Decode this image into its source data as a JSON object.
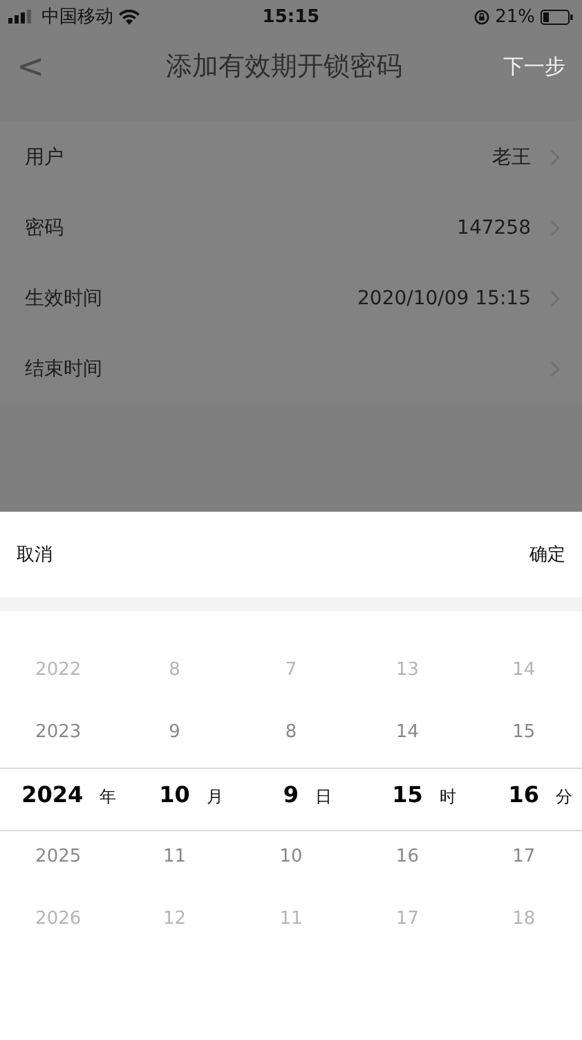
{
  "status_bar": {
    "carrier": "中国移动",
    "time": "15:15",
    "battery": "21%"
  },
  "nav": {
    "back": "<",
    "title": "添加有效期开锁密码",
    "action": "下一步"
  },
  "rows": [
    {
      "label": "用户",
      "value": "老王"
    },
    {
      "label": "密码",
      "value": "147258"
    },
    {
      "label": "生效时间",
      "value": "2020/10/09 15:15"
    },
    {
      "label": "结束时间"
    }
  ],
  "picker": {
    "cancel": "取消",
    "confirm": "确定",
    "columns": [
      {
        "unit": "年",
        "items": [
          {
            "text": "2022",
            "selected": false
          },
          {
            "text": "2023",
            "selected": false
          },
          {
            "text": "2024",
            "selected": true
          },
          {
            "text": "2025",
            "selected": false
          },
          {
            "text": "2026",
            "selected": false
          }
        ]
      },
      {
        "unit": "月",
        "items": [
          {
            "text": "8",
            "selected": false
          },
          {
            "text": "9",
            "selected": false
          },
          {
            "text": "10",
            "selected": true
          },
          {
            "text": "11",
            "selected": false
          },
          {
            "text": "12",
            "selected": false
          }
        ]
      },
      {
        "unit": "日",
        "items": [
          {
            "text": "7",
            "selected": false
          },
          {
            "text": "8",
            "selected": false
          },
          {
            "text": "9",
            "selected": true
          },
          {
            "text": "10",
            "selected": false
          },
          {
            "text": "11",
            "selected": false
          }
        ]
      },
      {
        "unit": "时",
        "items": [
          {
            "text": "13",
            "selected": false
          },
          {
            "text": "14",
            "selected": false
          },
          {
            "text": "15",
            "selected": true
          },
          {
            "text": "16",
            "selected": false
          },
          {
            "text": "17",
            "selected": false
          }
        ]
      },
      {
        "unit": "分",
        "items": [
          {
            "text": "14",
            "selected": false
          },
          {
            "text": "15",
            "selected": false
          },
          {
            "text": "16",
            "selected": true
          },
          {
            "text": "17",
            "selected": false
          },
          {
            "text": "18",
            "selected": false
          }
        ]
      }
    ]
  }
}
